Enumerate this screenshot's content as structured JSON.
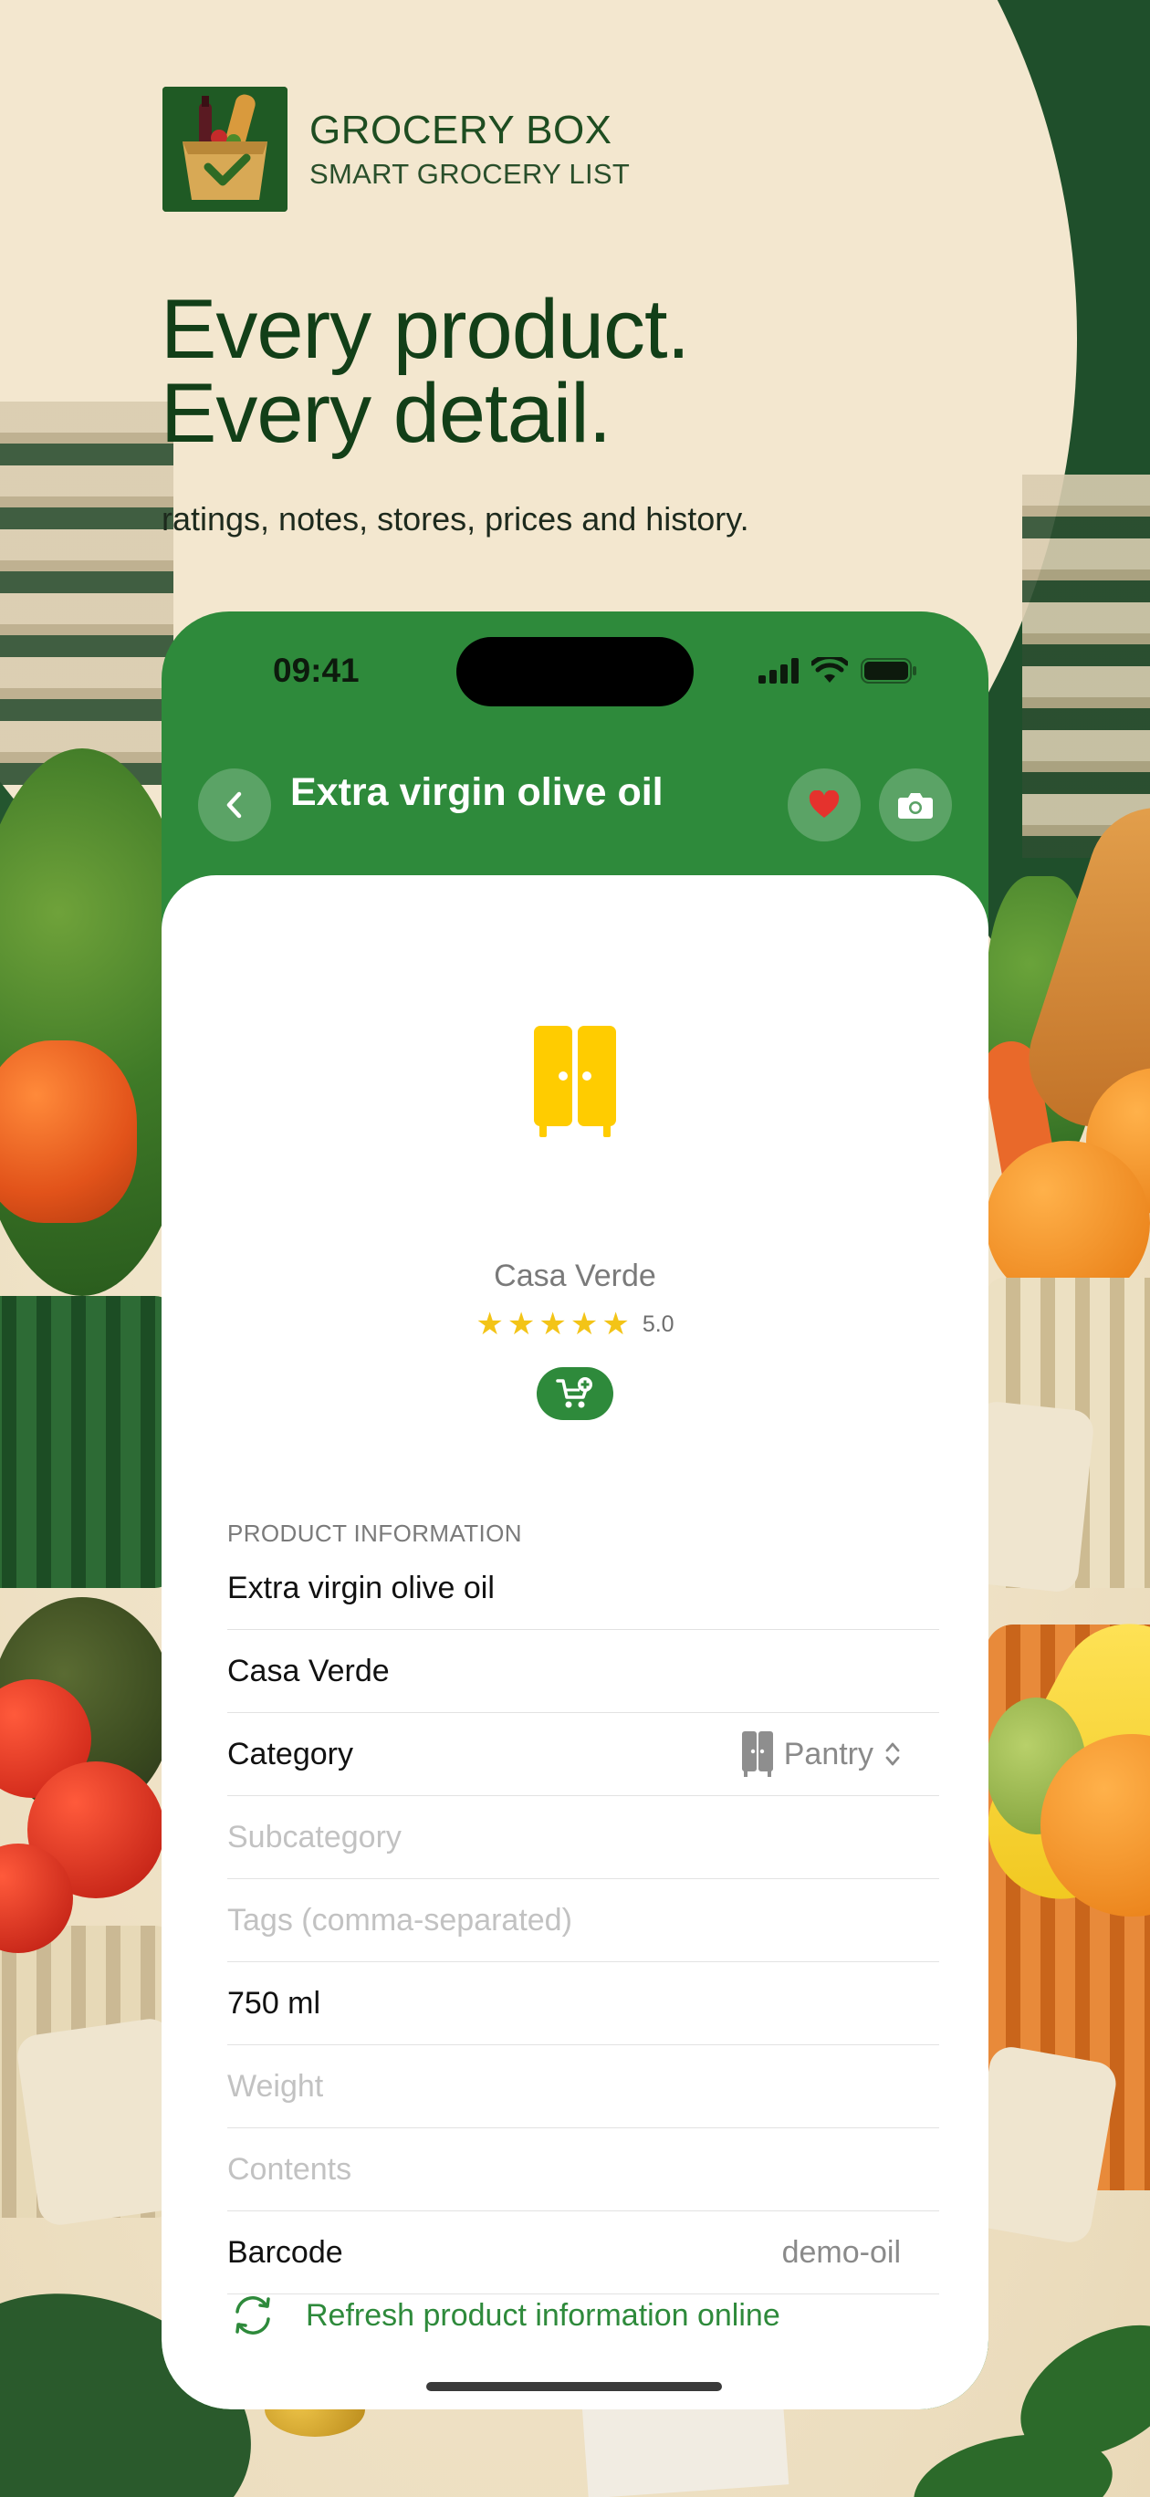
{
  "promo": {
    "brand_name": "GROCERY BOX",
    "brand_tagline": "SMART GROCERY LIST",
    "headline_line1": "Every product.",
    "headline_line2": "Every detail.",
    "subheadline": "ratings, notes, stores, prices and history."
  },
  "status_bar": {
    "time": "09:41",
    "icons": [
      "cellular-signal-icon",
      "wifi-icon",
      "battery-icon"
    ]
  },
  "nav": {
    "title": "Extra virgin olive oil",
    "back_icon": "chevron-left-icon",
    "favorite_icon": "heart-icon",
    "camera_icon": "camera-icon"
  },
  "product": {
    "category_icon": "pantry-cabinet-icon",
    "brand": "Casa Verde",
    "rating_stars": 5,
    "rating_value": "5.0",
    "add_to_cart_icon": "cart-plus-icon"
  },
  "info": {
    "section_title": "PRODUCT INFORMATION",
    "name_value": "Extra virgin olive oil",
    "brand_value": "Casa Verde",
    "category_label": "Category",
    "category_value": "Pantry",
    "subcategory_placeholder": "Subcategory",
    "tags_placeholder": "Tags (comma-separated)",
    "volume_value": "750 ml",
    "weight_placeholder": "Weight",
    "contents_placeholder": "Contents",
    "barcode_label": "Barcode",
    "barcode_value": "demo-oil",
    "refresh_label": "Refresh product information online"
  },
  "colors": {
    "brand_green": "#2E8A3B",
    "dark_green": "#123F18",
    "star_yellow": "#F3C417",
    "pantry_yellow": "#FFCC00",
    "heart_red": "#E5322D"
  }
}
